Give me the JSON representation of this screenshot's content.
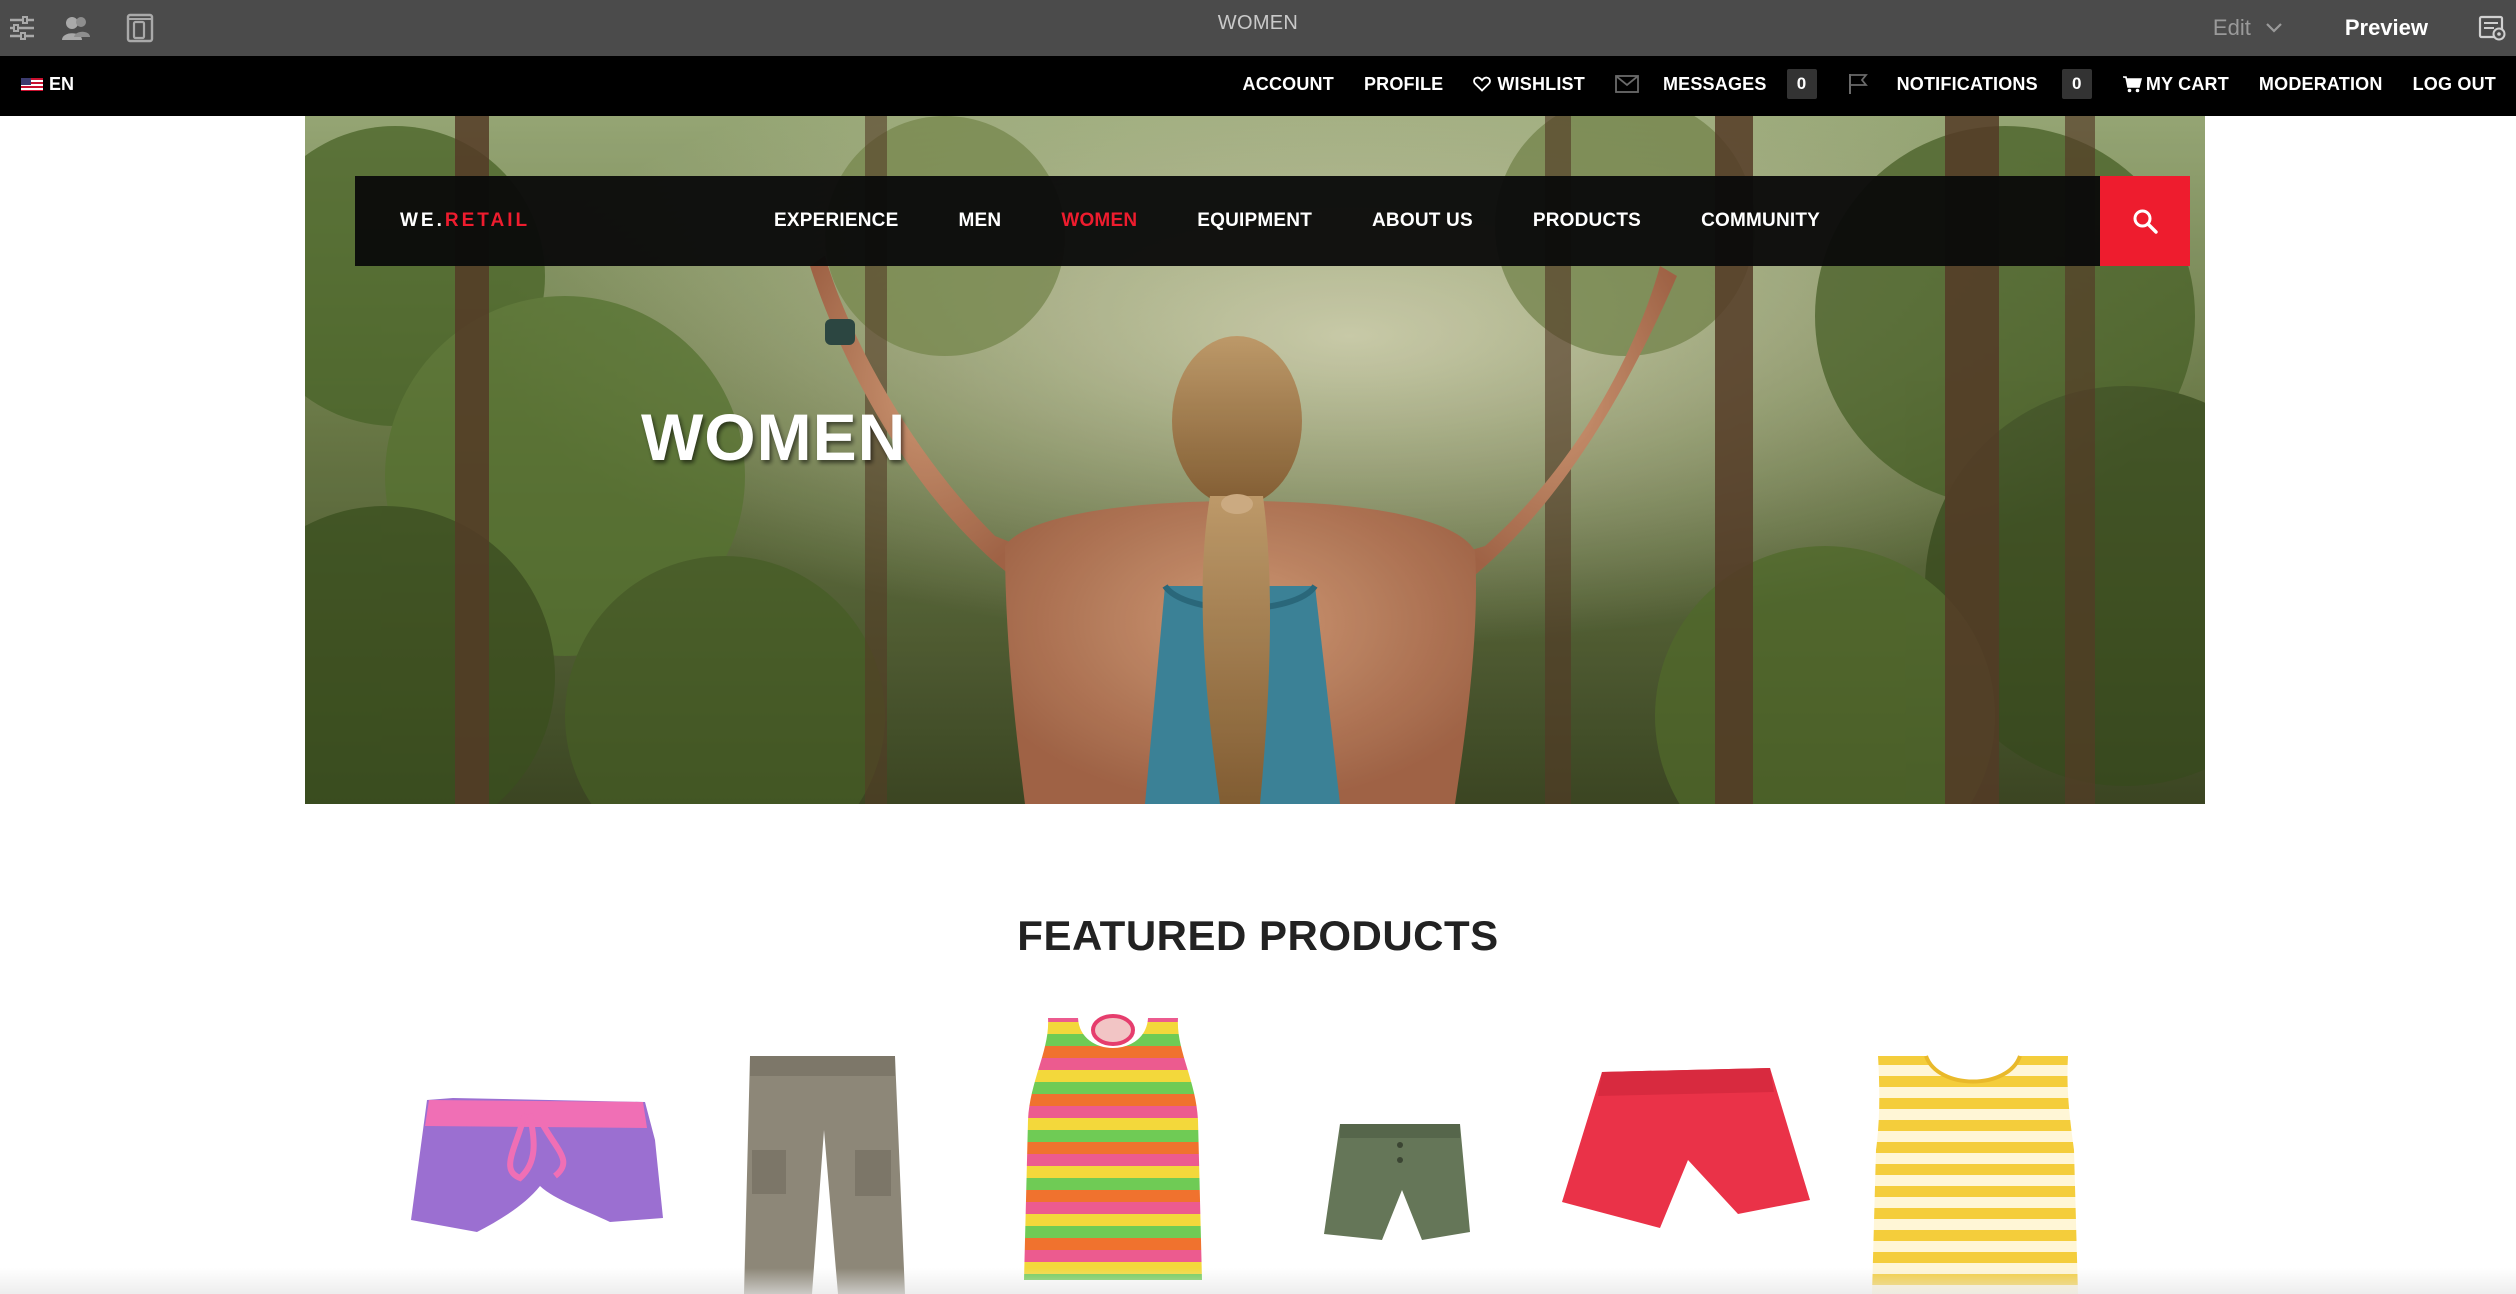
{
  "editor": {
    "page_title": "WOMEN",
    "mode_label": "Edit",
    "preview_label": "Preview",
    "icons": [
      "side-panel-icon",
      "personalization-icon",
      "emulator-icon",
      "page-info-icon"
    ]
  },
  "community_bar": {
    "language": "EN",
    "links": {
      "account": "ACCOUNT",
      "profile": "PROFILE",
      "wishlist": "WISHLIST",
      "messages": "MESSAGES",
      "messages_count": "0",
      "notifications": "NOTIFICATIONS",
      "notifications_count": "0",
      "my_cart": "MY CART",
      "moderation": "MODERATION",
      "log_out": "LOG OUT"
    }
  },
  "site": {
    "brand_prefix": "WE.",
    "brand_accent": "RETAIL",
    "nav": [
      "EXPERIENCE",
      "MEN",
      "WOMEN",
      "EQUIPMENT",
      "ABOUT US",
      "PRODUCTS",
      "COMMUNITY"
    ],
    "active_nav": "WOMEN",
    "hero_title": "WOMEN"
  },
  "featured": {
    "title": "FEATURED PRODUCTS",
    "products": [
      "purple-pink-shorts",
      "grey-cargo-pants",
      "striped-tank-top",
      "olive-shorts",
      "red-shorts",
      "yellow-striped-tank"
    ]
  },
  "colors": {
    "accent": "#ee1c2e",
    "editor_bar": "#4b4b4b",
    "community_bar": "#000000"
  }
}
